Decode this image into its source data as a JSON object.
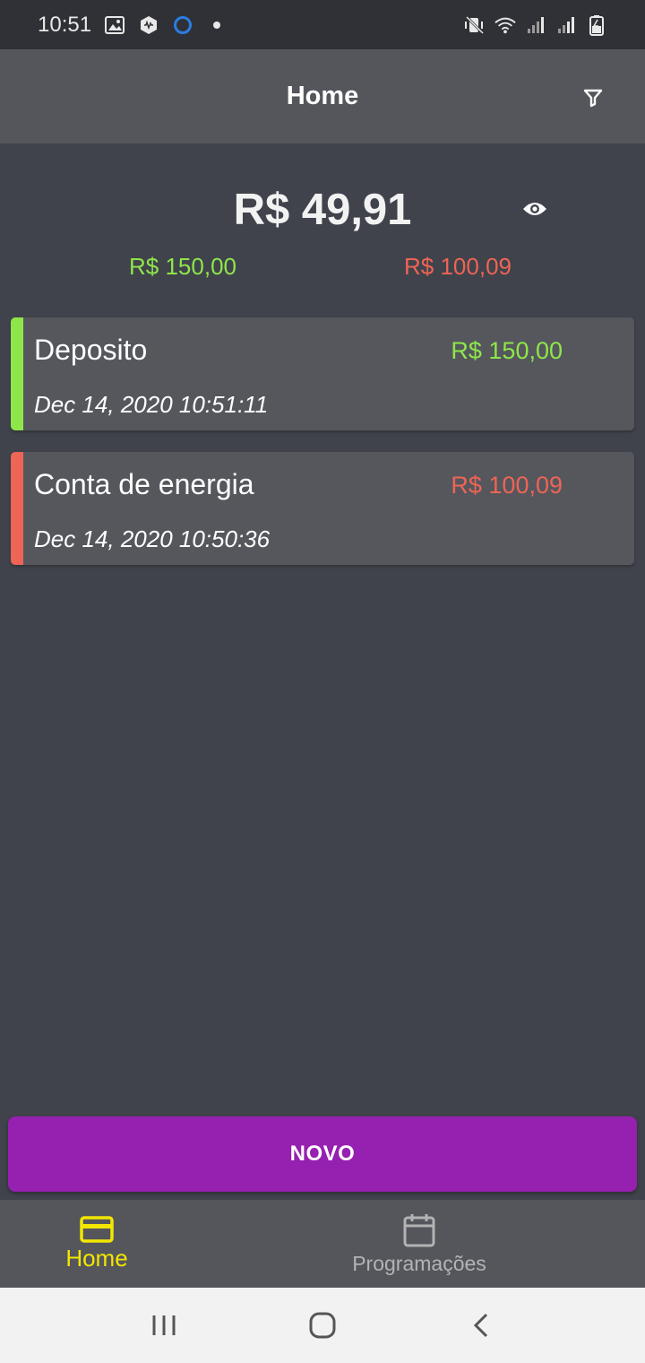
{
  "status_bar": {
    "time": "10:51",
    "icons_left": [
      "image-icon",
      "app-badge-icon",
      "circle-icon",
      "dot-icon"
    ],
    "icons_right": [
      "mute-vibrate-icon",
      "wifi-icon",
      "signal-icon",
      "signal-icon",
      "battery-icon"
    ]
  },
  "header": {
    "title": "Home",
    "filter_icon": "filter-icon"
  },
  "summary": {
    "balance": "R$ 49,91",
    "income_total": "R$ 150,00",
    "expense_total": "R$ 100,09",
    "visibility_icon": "eye-icon"
  },
  "transactions": [
    {
      "name": "Deposito",
      "amount": "R$ 150,00",
      "date": "Dec 14, 2020 10:51:11",
      "type": "income"
    },
    {
      "name": "Conta de energia",
      "amount": "R$ 100,09",
      "date": "Dec 14, 2020 10:50:36",
      "type": "expense"
    }
  ],
  "actions": {
    "new_label": "NOVO"
  },
  "bottom_nav": {
    "items": [
      {
        "label": "Home",
        "icon": "credit-card-icon",
        "active": true
      },
      {
        "label": "Programações",
        "icon": "calendar-icon",
        "active": false
      }
    ]
  },
  "colors": {
    "background": "#40434b",
    "surface": "#55575d",
    "income": "#8ee64a",
    "expense": "#ee6455",
    "accent": "#9620b0",
    "nav_active": "#f3e600"
  }
}
